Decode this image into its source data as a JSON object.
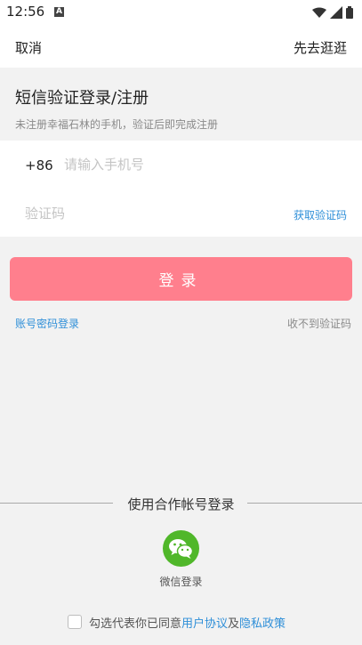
{
  "status_bar": {
    "time": "12:56",
    "notification_glyph": "A",
    "icons": [
      "wifi-icon",
      "signal-icon",
      "battery-icon"
    ]
  },
  "top_bar": {
    "cancel_label": "取消",
    "skip_label": "先去逛逛"
  },
  "header": {
    "title": "短信验证登录/注册",
    "subtitle": "未注册幸福石林的手机，验证后即完成注册"
  },
  "form": {
    "country_code": "+86",
    "phone_placeholder": "请输入手机号",
    "phone_value": "",
    "code_placeholder": "验证码",
    "code_value": "",
    "get_code_label": "获取验证码"
  },
  "login_button_label": "登录",
  "links": {
    "password_login": "账号密码登录",
    "no_code": "收不到验证码"
  },
  "partner_login": {
    "title": "使用合作帐号登录",
    "wechat_label": "微信登录"
  },
  "agreement": {
    "prefix": "勾选代表你已同意",
    "user_agreement": "用户协议",
    "and": "及",
    "privacy_policy": "隐私政策",
    "checked": false
  },
  "colors": {
    "accent": "#ff7f8d",
    "link": "#2f8fd8",
    "wechat": "#50b72a"
  }
}
